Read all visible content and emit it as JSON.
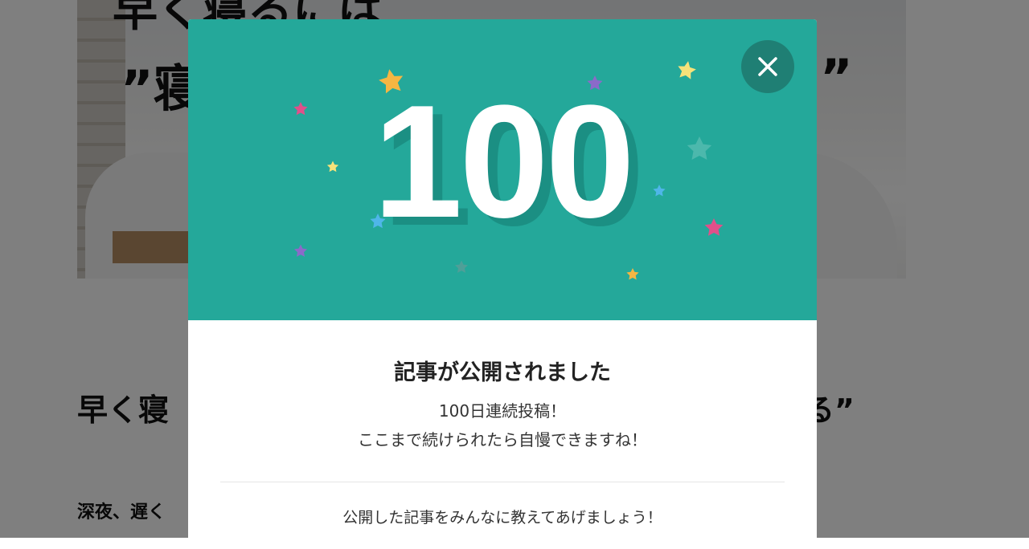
{
  "background": {
    "hero_title_line1": "早く寝るには",
    "hero_title_line2": "”寝",
    "hero_quote_right": "”",
    "article_title_start": "早く寝",
    "article_title_end": "る”",
    "article_body_start": "深夜、遅く"
  },
  "modal": {
    "badge_number": "100",
    "close_icon": "close-icon",
    "title": "記事が公開されました",
    "message_line1": "100日連続投稿！",
    "message_line2": "ここまで続けられたら自慢できますね！",
    "share_prompt": "公開した記事をみんなに教えてあげましょう！"
  },
  "colors": {
    "modal_header": "#24a89a",
    "close_button": "#1f7f74",
    "number_shadow": "#1b8f83",
    "overlay": "rgba(0,0,0,0.5)"
  }
}
